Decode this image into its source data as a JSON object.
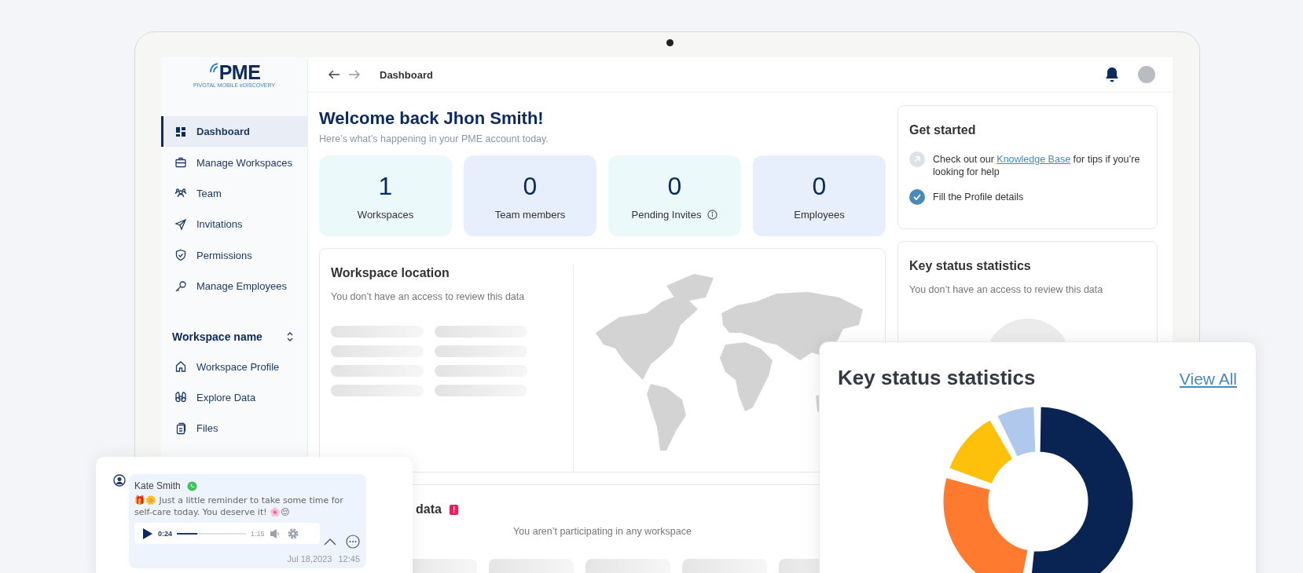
{
  "sidebar": {
    "logo": {
      "mark": "PME",
      "tagline": "PIVOTAL MOBILE eDISCOVERY"
    },
    "items": [
      {
        "label": "Dashboard",
        "selected": true
      },
      {
        "label": "Manage Workspaces",
        "selected": false
      },
      {
        "label": "Team",
        "selected": false
      },
      {
        "label": "Invitations",
        "selected": false
      },
      {
        "label": "Permissions",
        "selected": false
      },
      {
        "label": "Manage Employees",
        "selected": false
      }
    ],
    "workspace": {
      "title": "Workspace name",
      "items": [
        {
          "label": "Workspace Profile",
          "selected": false
        },
        {
          "label": "Explore Data",
          "selected": false
        },
        {
          "label": "Files",
          "selected": false
        }
      ]
    }
  },
  "topbar": {
    "title": "Dashboard"
  },
  "welcome": {
    "title": "Welcome back Jhon Smith!",
    "subtitle": "Here’s what’s  happening in your PME account today."
  },
  "stats": [
    {
      "value": "1",
      "label": "Workspaces",
      "info": false,
      "color": "#ebf9fb"
    },
    {
      "value": "0",
      "label": "Team members",
      "info": false,
      "color": "#e6effb"
    },
    {
      "value": "0",
      "label": "Pending Invites",
      "info": true,
      "color": "#ebf9fb"
    },
    {
      "value": "0",
      "label": "Employees",
      "info": false,
      "color": "#e6effb"
    }
  ],
  "location": {
    "title": "Workspace location",
    "message": "You don’t have an access to review this data"
  },
  "get_started": {
    "title": "Get started",
    "items": [
      {
        "before": "Check out our ",
        "link": "Knowledge Base",
        "after": " for tips if you’re looking for help",
        "done": false
      },
      {
        "before": "Fill the Profile details",
        "done": true
      }
    ]
  },
  "key_status": {
    "title": "Key status statistics",
    "message": "You don’t have an access to review this data"
  },
  "participation": {
    "title": "data",
    "badge": "!",
    "message": "You aren’t participating in any workspace"
  },
  "chat": {
    "sender": "Kate Smith",
    "message": "🎁🌼 Just a little reminder to take some time for self-care today. You deserve it! 🌸😌",
    "audio": {
      "elapsed": "0:24",
      "duration": "1:15",
      "level": 0.3
    },
    "date": "Jul 18,2023",
    "time": "12:45"
  },
  "stats_popup": {
    "title": "Key status statistics",
    "link": "View All"
  }
}
